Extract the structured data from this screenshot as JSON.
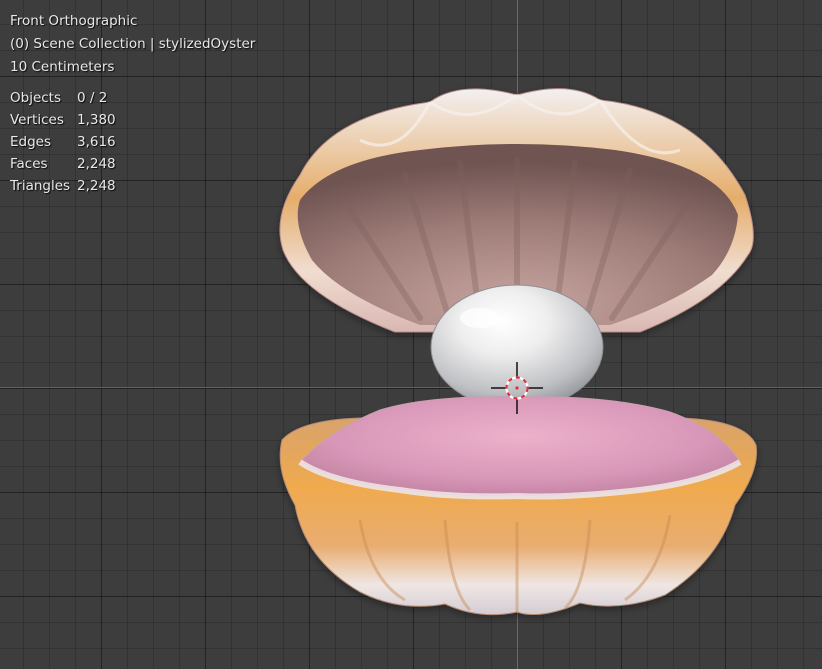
{
  "overlay": {
    "view_name": "Front Orthographic",
    "collection": "(0) Scene Collection | stylizedOyster",
    "scale": "10 Centimeters"
  },
  "stats": [
    {
      "label": "Objects",
      "value": "0 / 2"
    },
    {
      "label": "Vertices",
      "value": "1,380"
    },
    {
      "label": "Edges",
      "value": "3,616"
    },
    {
      "label": "Faces",
      "value": "2,248"
    },
    {
      "label": "Triangles",
      "value": "2,248"
    }
  ],
  "colors": {
    "viewport_bg": "#3d3d3d",
    "x_axis": "#a8404a",
    "z_axis": "#3f6fb8",
    "shell_orange": "#e0a35d",
    "shell_inner": "#a7817a",
    "lining_pink": "#dca0bf",
    "pearl": "#ececec",
    "cursor_red": "#e03040"
  }
}
